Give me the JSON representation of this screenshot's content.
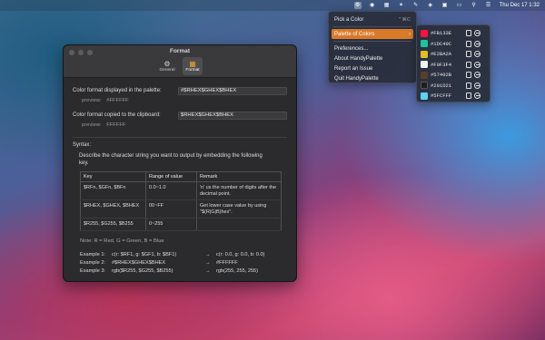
{
  "menubar": {
    "clock": "Thu Dec 17  1:32"
  },
  "menu": {
    "items": [
      {
        "label": "Pick a Color",
        "shortcut": "⌃⌘C"
      },
      {
        "label": "Palette of Colors",
        "shortcut": "›"
      },
      {
        "label": "Preferences...",
        "shortcut": ""
      },
      {
        "label": "About HandyPalette",
        "shortcut": ""
      },
      {
        "label": "Report an Issue",
        "shortcut": ""
      },
      {
        "label": "Quit HandyPalette",
        "shortcut": ""
      }
    ]
  },
  "palette": {
    "colors": [
      {
        "hex": "#FB133E",
        "color": "#FB133E"
      },
      {
        "hex": "#1DC49C",
        "color": "#1DC49C"
      },
      {
        "hex": "#E2BA2A",
        "color": "#E2BA2A"
      },
      {
        "hex": "#F0F3F4",
        "color": "#F0F3F4"
      },
      {
        "hex": "#57402B",
        "color": "#57402B"
      },
      {
        "hex": "#201D21",
        "color": "#201D21"
      },
      {
        "hex": "#5FCFFF",
        "color": "#5FCFFF"
      }
    ]
  },
  "window": {
    "title": "Format",
    "tabs": [
      {
        "label": "General"
      },
      {
        "label": "Format"
      }
    ],
    "palette_format": {
      "label": "Color format displayed in the palette:",
      "value": "#$RHEX$GHEX$BHEX",
      "preview_label": "preview:",
      "preview_value": "#FFFFFF"
    },
    "clipboard_format": {
      "label": "Color format copied to the clipboard:",
      "value": "$RHEX$GHEX$BHEX",
      "preview_label": "preview:",
      "preview_value": "FFFFFF"
    },
    "syntax": {
      "title": "Syntax:",
      "description": "Describe the character string you want to output by embedding the following key.",
      "headers": [
        "Key",
        "Range of value",
        "Remark"
      ],
      "rows": [
        {
          "key": "$RFn, $GFn, $BFn",
          "range": "0.0~1.0",
          "remark": "'n' us the number of digits after the decimal point."
        },
        {
          "key": "$RHEX, $GHEX, $BHEX",
          "range": "00~FF",
          "remark": "Get lower case value by using \"$(R|G|B)hex\"."
        },
        {
          "key": "$R255, $G255, $B255",
          "range": "0~255",
          "remark": ""
        }
      ],
      "note": "Note: R = Red, G = Green, B = Blue",
      "examples": [
        {
          "label": "Example 1:",
          "input": "c(r: $RF1, g: $GF1, b: $BF1)",
          "arrow": "→",
          "output": "c(r: 0.0, g: 0.0, b: 0.0)"
        },
        {
          "label": "Example 2:",
          "input": "#$RHEX$GHEX$BHEX",
          "arrow": "→",
          "output": "#FFFFFF"
        },
        {
          "label": "Example 3:",
          "input": "rgb($R255, $G255, $B255)",
          "arrow": "→",
          "output": "rgb(255, 255, 255)"
        }
      ]
    }
  }
}
